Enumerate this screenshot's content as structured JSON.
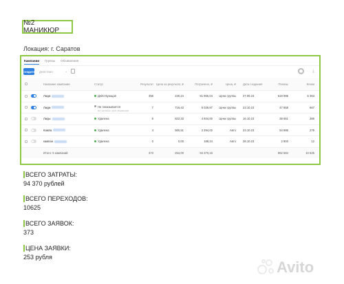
{
  "title": "№2 МАНИКЮР",
  "location": "Локация: г. Саратов",
  "screenshot": {
    "tabs": [
      "Кампании",
      "Группы",
      "Объявления"
    ],
    "primary_button": "Создать",
    "actions_placeholder": "Действия",
    "headers": [
      "Название кампании",
      "Статус",
      "Результат",
      "Цена за результат, ₽",
      "Потрачено, ₽",
      "Цена, ₽",
      "Дата создания",
      "Показы",
      "Клики"
    ],
    "rows": [
      {
        "name": "Лидм",
        "status": "Действующая",
        "status_note": "",
        "results": "356",
        "cpr": "230,24",
        "spent": "81 965,04",
        "price": "Цена группы",
        "date": "27.09.23",
        "impressions": "618 996",
        "clicks": "5 363",
        "active": true
      },
      {
        "name": "Лидм",
        "status": "Не показывается",
        "status_note": "Нет активных групп объявлений",
        "results": "7",
        "cpr": "716,43",
        "spent": "5 028,87",
        "price": "Цена группы",
        "date": "23.10.23",
        "impressions": "47 658",
        "clicks": "667",
        "active": true
      },
      {
        "name": "Лиды",
        "status": "Удалена",
        "status_note": "",
        "results": "6",
        "cpr": "822,33",
        "spent": "4 934,00",
        "price": "Цена группы",
        "date": "16.10.23",
        "impressions": "38 661",
        "clicks": "366",
        "active": false
      },
      {
        "name": "Кампа",
        "status": "Удалена",
        "status_note": "",
        "results": "4",
        "cpr": "560,51",
        "spent": "2 294,02",
        "price": "Авто",
        "date": "23.10.23",
        "impressions": "54 886",
        "clicks": "279",
        "active": false
      },
      {
        "name": "кампан",
        "status": "Удалена",
        "status_note": "",
        "results": "0",
        "cpr": "0,00",
        "spent": "188,24",
        "price": "Авто",
        "date": "26.10.23",
        "impressions": "2 903",
        "clicks": "12",
        "active": false
      }
    ],
    "total": {
      "label": "Итого: 5 кампаний",
      "results": "373",
      "cpr": "253,00",
      "spent": "94 370,16",
      "impressions": "962 584",
      "clicks": "10 625"
    }
  },
  "stats": [
    {
      "label": "ВСЕГО ЗАТРАТЫ:",
      "value": "94 370 рублей"
    },
    {
      "label": "ВСЕГО ПЕРЕХОДОВ:",
      "value": "10625"
    },
    {
      "label": "ВСЕГО ЗАЯВОК:",
      "value": "373"
    },
    {
      "label": "ЦЕНА ЗАЯВКИ:",
      "value": "253 рубля"
    }
  ],
  "watermark": "Avito",
  "colors": {
    "accent": "#8dc63f",
    "primary": "#2a7de1",
    "active": "#4caf50",
    "paused": "#9e9e9e",
    "deleted": "#4caf50"
  }
}
